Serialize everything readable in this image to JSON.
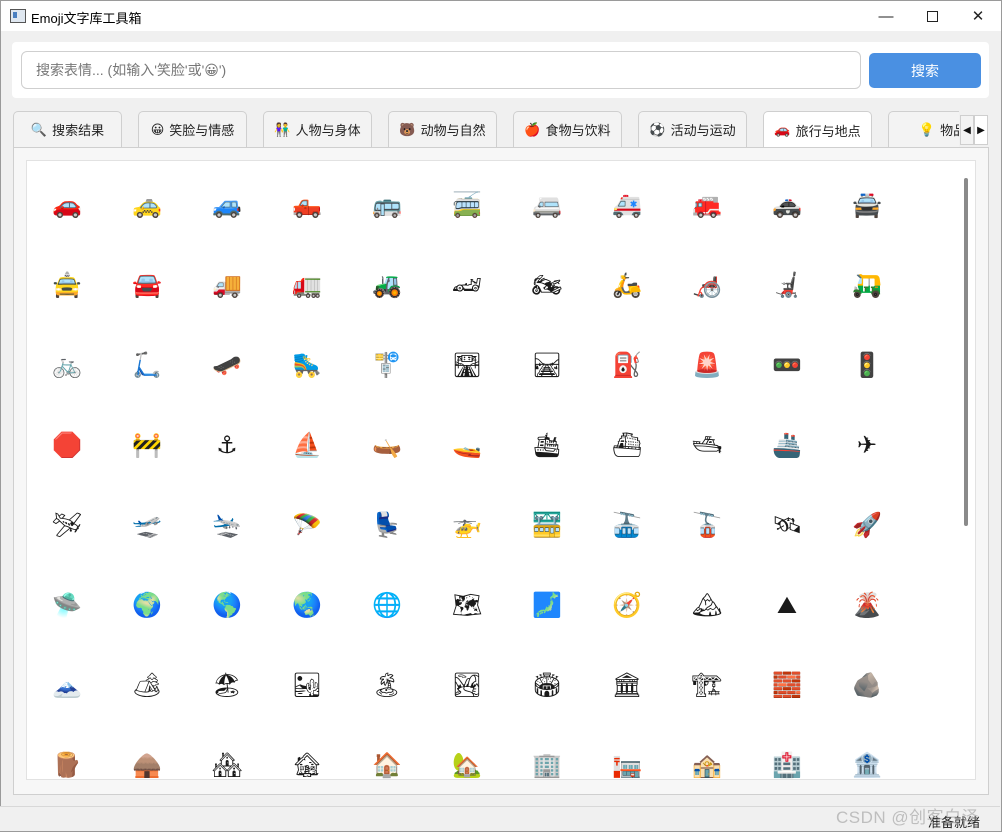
{
  "window": {
    "title": "Emoji文字库工具箱"
  },
  "search": {
    "placeholder": "搜索表情... (如输入'笑脸'或'😀')",
    "value": "",
    "button_label": "搜索"
  },
  "tabs": [
    {
      "icon": "🔍",
      "label": "搜索结果"
    },
    {
      "icon": "😀",
      "label": "笑脸与情感"
    },
    {
      "icon": "👫",
      "label": "人物与身体"
    },
    {
      "icon": "🐻",
      "label": "动物与自然"
    },
    {
      "icon": "🍎",
      "label": "食物与饮料"
    },
    {
      "icon": "⚽",
      "label": "活动与运动"
    },
    {
      "icon": "🚗",
      "label": "旅行与地点"
    },
    {
      "icon": "💡",
      "label": "物品"
    }
  ],
  "active_tab": "旅行与地点",
  "emojis": [
    [
      "🚗",
      "🚕",
      "🚙",
      "🛻",
      "🚌",
      "🚎",
      "🚐",
      "🚑",
      "🚒",
      "🚓",
      "🚔"
    ],
    [
      "🚖",
      "🚘",
      "🚚",
      "🚛",
      "🚜",
      "🏎",
      "🏍",
      "🛵",
      "🦽",
      "🦼",
      "🛺"
    ],
    [
      "🚲",
      "🛴",
      "🛹",
      "🛼",
      "🚏",
      "🛣",
      "🛤",
      "⛽",
      "🚨",
      "🚥",
      "🚦"
    ],
    [
      "🛑",
      "🚧",
      "⚓",
      "⛵",
      "🛶",
      "🚤",
      "🛳",
      "⛴",
      "🛥",
      "🚢",
      "✈"
    ],
    [
      "🛩",
      "🛫",
      "🛬",
      "🪂",
      "💺",
      "🚁",
      "🚟",
      "🚠",
      "🚡",
      "🛰",
      "🚀"
    ],
    [
      "🛸",
      "🌍",
      "🌎",
      "🌏",
      "🌐",
      "🗺",
      "🗾",
      "🧭",
      "🏔",
      "⛰",
      "🌋"
    ],
    [
      "🗻",
      "🏕",
      "🏖",
      "🏜",
      "🏝",
      "🏞",
      "🏟",
      "🏛",
      "🏗",
      "🧱",
      "🪨"
    ],
    [
      "🪵",
      "🛖",
      "🏘",
      "🏚",
      "🏠",
      "🏡",
      "🏢",
      "🏣",
      "🏤",
      "🏥",
      "🏦"
    ]
  ],
  "status": {
    "text": "准备就绪"
  },
  "watermark": "CSDN @创客白泽",
  "colors": {
    "accent": "#4a90e2"
  }
}
